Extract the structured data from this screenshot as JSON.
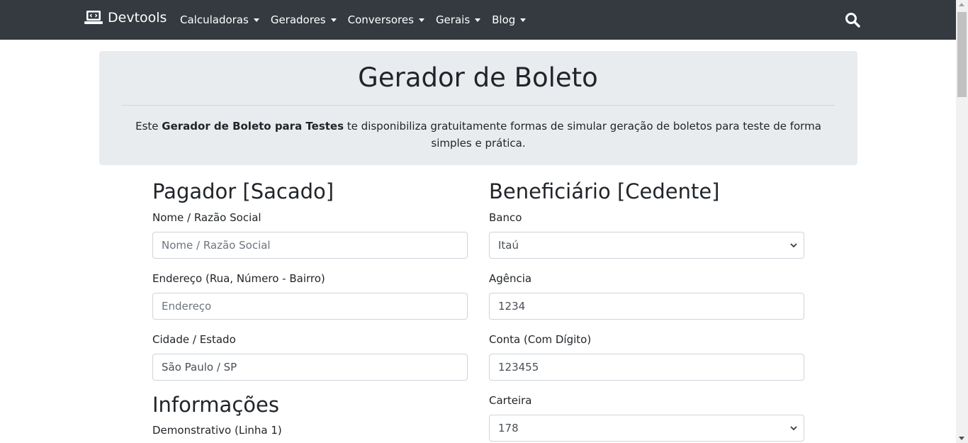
{
  "nav": {
    "brand": "Devtools",
    "items": [
      {
        "label": "Calculadoras"
      },
      {
        "label": "Geradores"
      },
      {
        "label": "Conversores"
      },
      {
        "label": "Gerais"
      },
      {
        "label": "Blog"
      }
    ],
    "search_icon": "search-icon"
  },
  "header": {
    "title": "Gerador de Boleto",
    "desc_pre": "Este ",
    "desc_bold": "Gerador de Boleto para Testes",
    "desc_post": " te disponibiliza gratuitamente formas de simular geração de boletos para teste de forma simples e prática."
  },
  "pagador": {
    "title": "Pagador [Sacado]",
    "nome_label": "Nome / Razão Social",
    "nome_placeholder": "Nome / Razão Social",
    "endereco_label": "Endereço (Rua, Número - Bairro)",
    "endereco_placeholder": "Endereço",
    "cidade_label": "Cidade / Estado",
    "cidade_value": "São Paulo / SP"
  },
  "informacoes": {
    "title": "Informações",
    "demonstrativo_label": "Demonstrativo (Linha 1)"
  },
  "beneficiario": {
    "title": "Beneficiário [Cedente]",
    "banco_label": "Banco",
    "banco_value": "Itaú",
    "agencia_label": "Agência",
    "agencia_value": "1234",
    "conta_label": "Conta (Com Dígito)",
    "conta_value": "123455",
    "carteira_label": "Carteira",
    "carteira_value": "178"
  },
  "colors": {
    "navbar": "#343a40",
    "jumbotron": "#e9ecef",
    "text": "#212529"
  }
}
